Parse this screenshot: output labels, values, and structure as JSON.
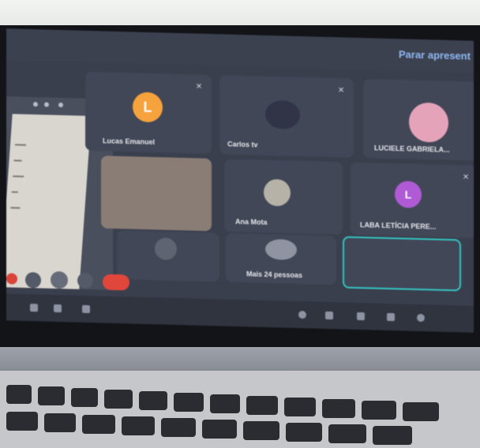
{
  "meeting": {
    "stop_presenting_label": "Parar apresent",
    "more_participants_label": "Mais 24 pessoas"
  },
  "participants": [
    {
      "name": "Lucas Emanuel",
      "initial": "L",
      "avatar_color": "#f6a23d",
      "muted": true
    },
    {
      "name": "Carlos tv",
      "muted": true
    },
    {
      "name": "LUCIELE GABRIELA...",
      "muted": false
    },
    {
      "name": "LABA LETÍCIA PERE...",
      "initial": "L",
      "avatar_color": "#b05ad6",
      "muted": true
    },
    {
      "name": "Ana Mota",
      "muted": false
    }
  ],
  "colors": {
    "screen_bg": "#3a3f4e",
    "tile_bg": "#414757",
    "accent_blue": "#8fb8f3",
    "end_call_red": "#e0473a",
    "highlight_teal": "#34c3c1"
  }
}
